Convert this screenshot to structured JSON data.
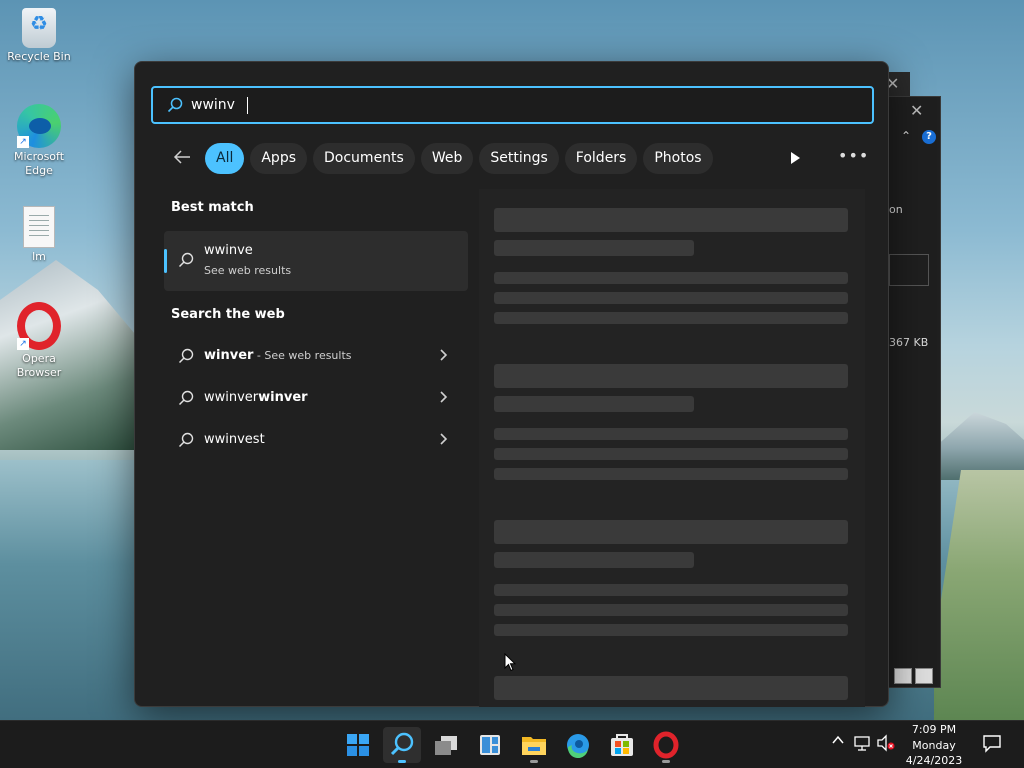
{
  "desktop": {
    "icons": [
      {
        "label": "Recycle Bin",
        "icon": "recycle-bin-icon"
      },
      {
        "label": "Microsoft Edge",
        "icon": "edge-icon"
      },
      {
        "label": "lm",
        "icon": "text-file-icon"
      },
      {
        "label": "Opera Browser",
        "icon": "opera-icon"
      }
    ]
  },
  "background_window": {
    "partial_label": "on",
    "size_text": "367 KB"
  },
  "search": {
    "query": "wwinv",
    "filters": [
      {
        "label": "All",
        "active": true
      },
      {
        "label": "Apps",
        "active": false
      },
      {
        "label": "Documents",
        "active": false
      },
      {
        "label": "Web",
        "active": false
      },
      {
        "label": "Settings",
        "active": false
      },
      {
        "label": "Folders",
        "active": false
      },
      {
        "label": "Photos",
        "active": false
      }
    ],
    "more_label": "•••",
    "best_match": {
      "heading": "Best match",
      "title": "wwinve",
      "subtitle": "See web results"
    },
    "search_web": {
      "heading": "Search the web",
      "items": [
        {
          "prefix": "",
          "bold": "winver",
          "suffix": " - See web results"
        },
        {
          "prefix": "wwinver",
          "bold": "winver",
          "suffix": ""
        },
        {
          "prefix": "wwinvest",
          "bold": "",
          "suffix": ""
        }
      ]
    }
  },
  "taskbar": {
    "apps": [
      "start-icon",
      "search-icon",
      "task-view-icon",
      "widgets-icon",
      "file-explorer-icon",
      "edge-icon",
      "store-icon",
      "opera-icon"
    ],
    "clock": {
      "time": "7:09 PM",
      "day": "Monday",
      "date": "4/24/2023"
    }
  },
  "colors": {
    "accent": "#4cc2ff",
    "panel": "#202020",
    "taskbar": "#1c1c1c"
  }
}
